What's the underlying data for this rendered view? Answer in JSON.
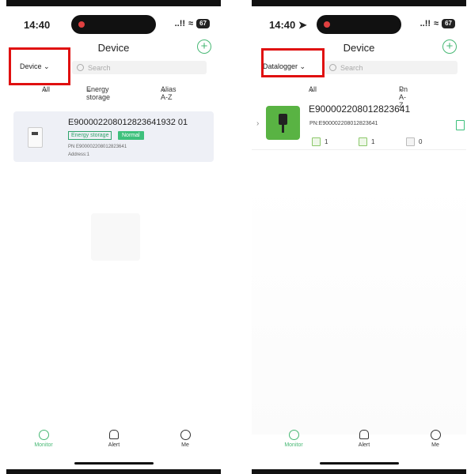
{
  "left": {
    "time": "14:40",
    "signal": "..!!",
    "battery": "67",
    "title": "Device",
    "type_dropdown": "Device",
    "search_placeholder": "Search",
    "filters": {
      "all": "All",
      "type": "Energy storage",
      "sort": "Alias A-Z"
    },
    "device": {
      "serial": "E900002208012823641932 01",
      "serial_full": "E900002208012823641932 01",
      "tag_type": "Energy storage",
      "tag_status": "Normal",
      "pn": "PN  E900002208012823641",
      "pn_full": "PN  E900002208012823641",
      "address": "Address:1"
    },
    "tabs": [
      "Monitor",
      "Alert",
      "Me"
    ]
  },
  "right": {
    "time": "14:40",
    "signal": "..!!",
    "battery": "67",
    "title": "Device",
    "type_dropdown": "Datalogger",
    "search_placeholder": "Search",
    "filters": {
      "all": "All",
      "sort": "Pn A-Z"
    },
    "datalogger": {
      "serial": "E900002208012823641",
      "pn": "PN:E900002208012823641",
      "stat1": "1",
      "stat2": "1",
      "stat3": "0"
    },
    "tabs": [
      "Monitor",
      "Alert",
      "Me"
    ]
  },
  "colors": {
    "accent": "#47b874",
    "highlight_box": "#e01010",
    "tag_green": "#3ec07c"
  },
  "icons": [
    "add-device-icon",
    "search-icon",
    "chevron-down-icon",
    "monitor-icon",
    "bell-icon",
    "profile-icon",
    "datalogger-icon"
  ]
}
